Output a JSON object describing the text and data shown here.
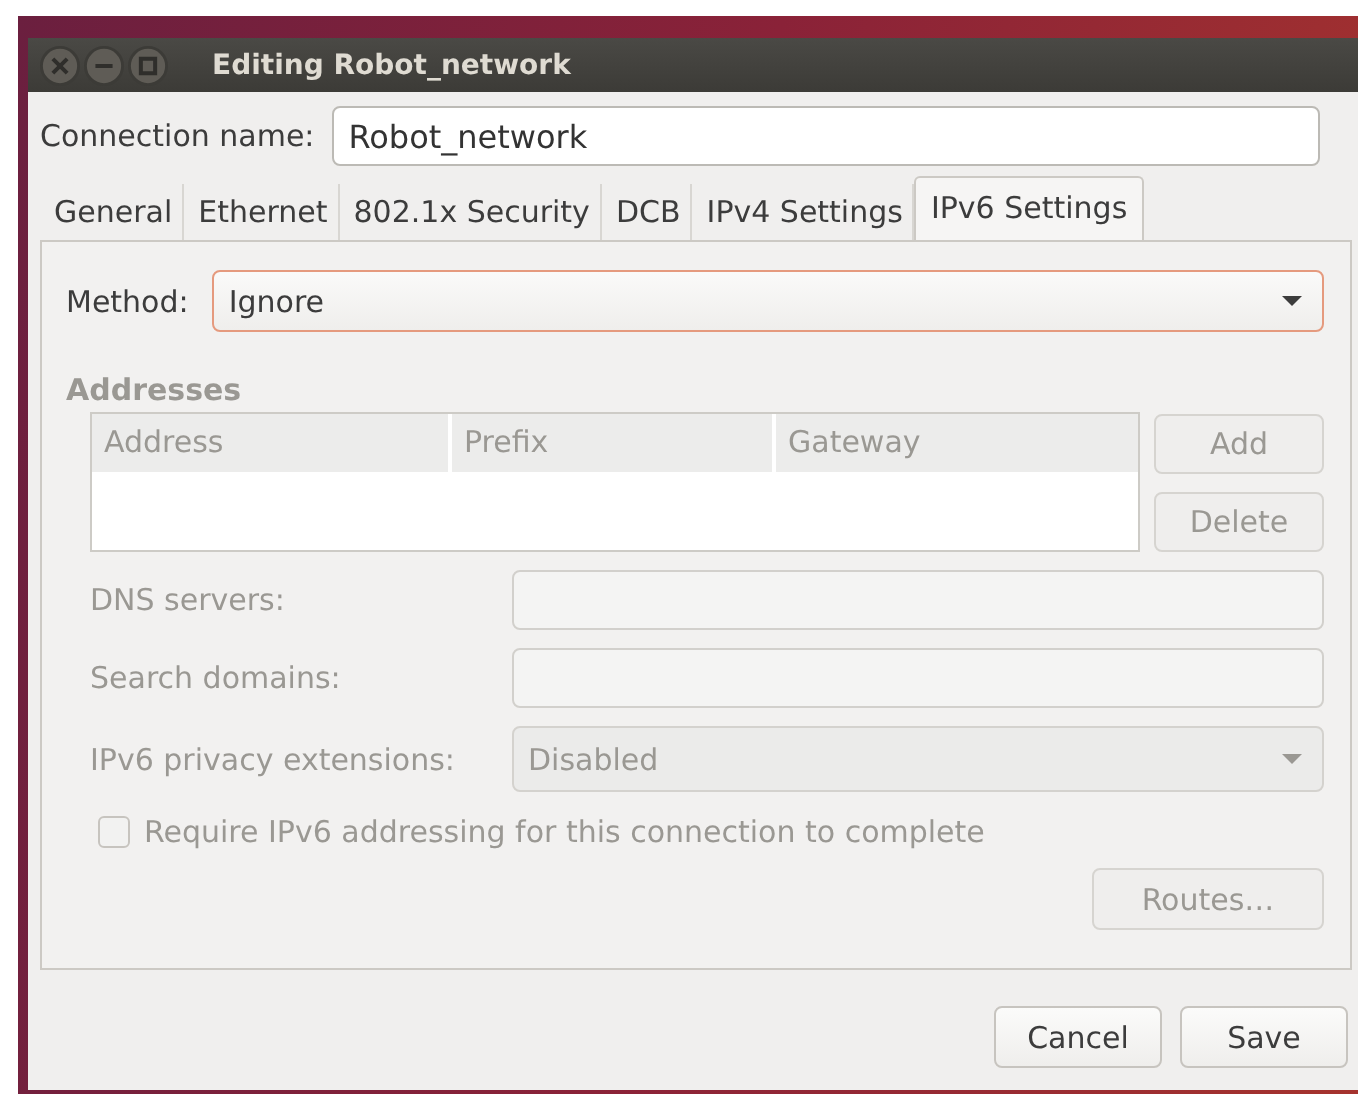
{
  "window": {
    "title": "Editing Robot_network",
    "controls": [
      {
        "kind": "close"
      },
      {
        "kind": "minimize"
      },
      {
        "kind": "maximize"
      }
    ]
  },
  "connection_name": {
    "label": "Connection name:",
    "value": "Robot_network"
  },
  "tabs": [
    {
      "label": "General",
      "selected": false
    },
    {
      "label": "Ethernet",
      "selected": false
    },
    {
      "label": "802.1x Security",
      "selected": false
    },
    {
      "label": "DCB",
      "selected": false
    },
    {
      "label": "IPv4 Settings",
      "selected": false
    },
    {
      "label": "IPv6 Settings",
      "selected": true
    }
  ],
  "method": {
    "label": "Method:",
    "value": "Ignore",
    "focused": true
  },
  "addresses": {
    "title": "Addresses",
    "disabled": true,
    "columns": [
      "Address",
      "Prefix",
      "Gateway"
    ],
    "buttons": [
      {
        "label": "Add",
        "disabled": true
      },
      {
        "label": "Delete",
        "disabled": true
      }
    ]
  },
  "fields": [
    {
      "kind": "text",
      "label": "DNS servers:",
      "disabled": true
    },
    {
      "kind": "text",
      "label": "Search domains:",
      "disabled": true
    },
    {
      "kind": "dropdown",
      "label": "IPv6 privacy extensions:",
      "value": "Disabled",
      "disabled": true
    }
  ],
  "require_checkbox": {
    "label": "Require IPv6 addressing for this connection to complete",
    "checked": false,
    "disabled": true
  },
  "routes_button": {
    "label": "Routes…",
    "disabled": true
  },
  "buttons": [
    {
      "label": "Cancel"
    },
    {
      "label": "Save"
    }
  ]
}
